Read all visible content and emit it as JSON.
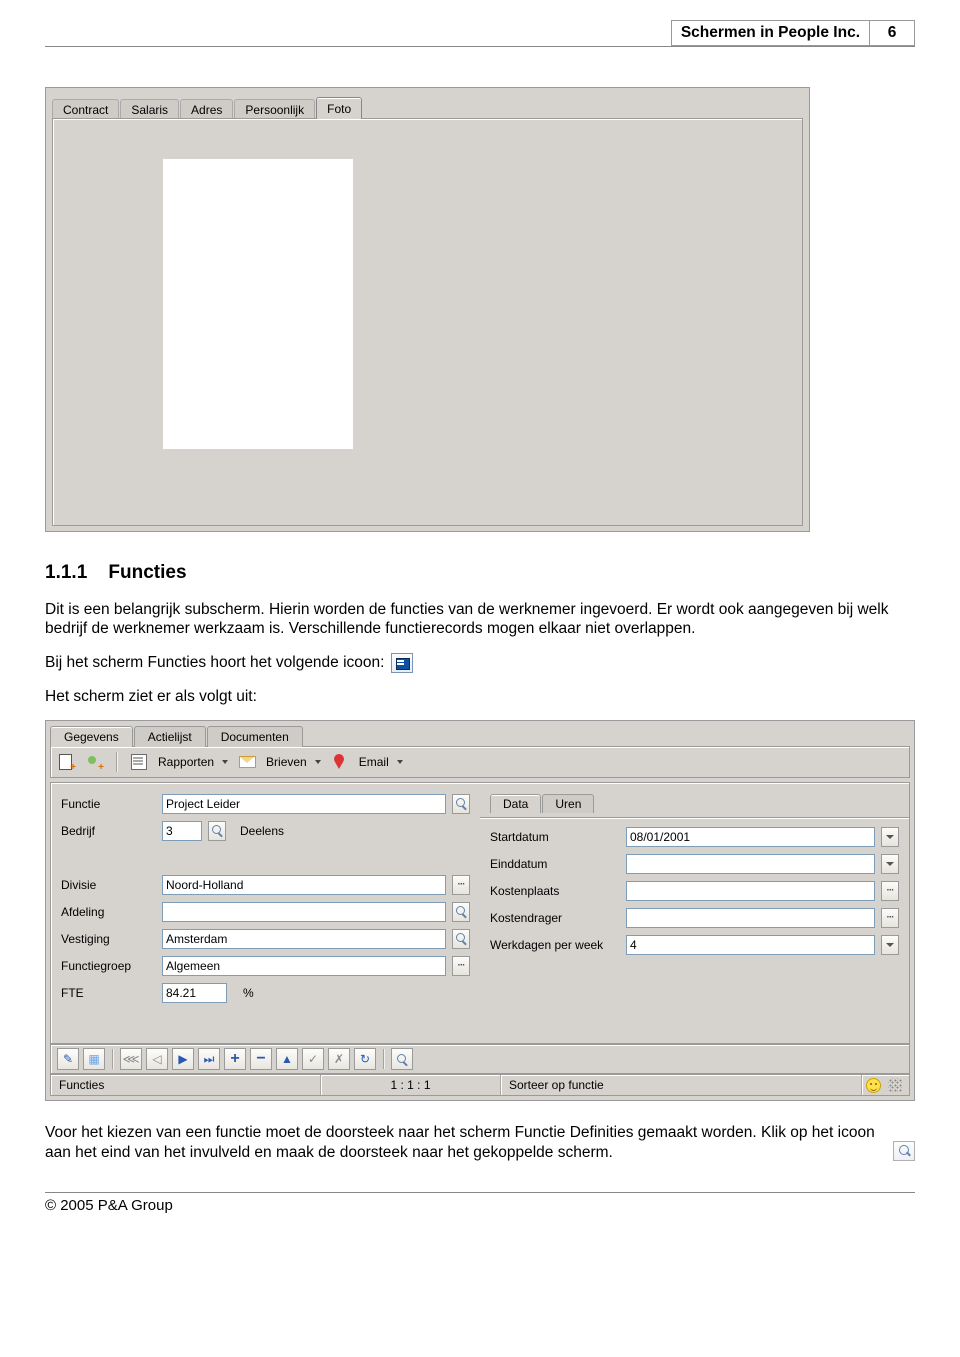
{
  "header": {
    "title": "Schermen in People Inc.",
    "page": "6"
  },
  "shot1": {
    "tabs": [
      "Contract",
      "Salaris",
      "Adres",
      "Persoonlijk",
      "Foto"
    ],
    "active_tab_index": 4
  },
  "section": {
    "number": "1.1.1",
    "title": "Functies"
  },
  "para1": "Dit is een belangrijk subscherm. Hierin worden de functies van de werknemer ingevoerd. Er wordt ook aangegeven bij welk bedrijf de werknemer werkzaam is. Verschillende functierecords mogen elkaar niet overlappen.",
  "para2_pre": "Bij het scherm Functies hoort het volgende icoon:",
  "para3": "Het scherm ziet er als volgt uit:",
  "shot2": {
    "top_tabs": [
      "Gegevens",
      "Actielijst",
      "Documenten"
    ],
    "top_active": 0,
    "toolbar": {
      "rapporten": "Rapporten",
      "brieven": "Brieven",
      "email": "Email"
    },
    "left": {
      "functie": {
        "label": "Functie",
        "value": "Project Leider"
      },
      "bedrijf": {
        "label": "Bedrijf",
        "value": "3",
        "name": "Deelens"
      },
      "divisie": {
        "label": "Divisie",
        "value": "Noord-Holland"
      },
      "afdeling": {
        "label": "Afdeling",
        "value": ""
      },
      "vestiging": {
        "label": "Vestiging",
        "value": "Amsterdam"
      },
      "functiegroep": {
        "label": "Functiegroep",
        "value": "Algemeen"
      },
      "fte": {
        "label": "FTE",
        "value": "84.21",
        "unit": "%"
      }
    },
    "right": {
      "inner_tabs": [
        "Data",
        "Uren"
      ],
      "inner_active": 0,
      "startdatum": {
        "label": "Startdatum",
        "value": "08/01/2001"
      },
      "einddatum": {
        "label": "Einddatum",
        "value": ""
      },
      "kostenplaats": {
        "label": "Kostenplaats",
        "value": ""
      },
      "kostendrager": {
        "label": "Kostendrager",
        "value": ""
      },
      "werkdagen": {
        "label": "Werkdagen per week",
        "value": "4"
      }
    },
    "status": {
      "left": "Functies",
      "counter": "1 : 1 : 1",
      "sort": "Sorteer op functie"
    }
  },
  "para4": "Voor het kiezen van een functie moet de doorsteek naar het scherm Functie Definities gemaakt worden. Klik op het icoon aan het eind van het invulveld en maak de doorsteek naar het gekoppelde scherm.",
  "footer": "© 2005 P&A Group"
}
